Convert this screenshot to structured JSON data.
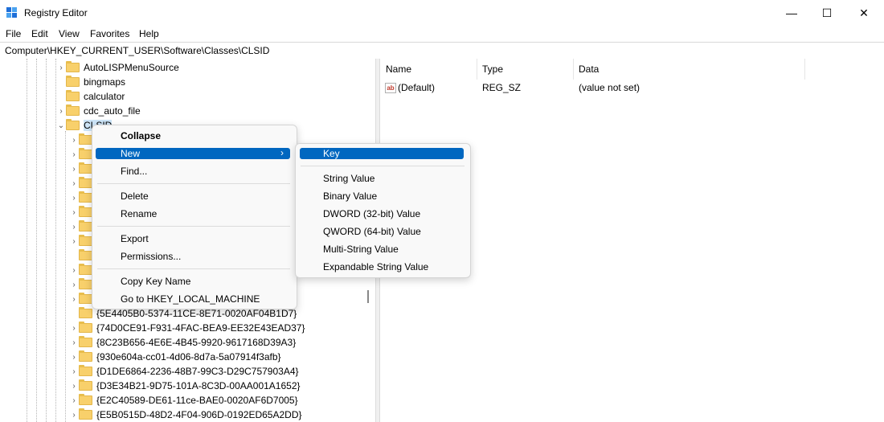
{
  "window": {
    "title": "Registry Editor",
    "minimize": "—",
    "maximize": "☐",
    "close": "✕"
  },
  "menu": [
    "File",
    "Edit",
    "View",
    "Favorites",
    "Help"
  ],
  "address": "Computer\\HKEY_CURRENT_USER\\Software\\Classes\\CLSID",
  "tree": {
    "top_items": [
      "AutoLISPMenuSource",
      "bingmaps",
      "calculator",
      "cdc_auto_file",
      "CLSID"
    ],
    "child_items": [
      "{5E4405B0-5374-11CE-8E71-0020AF04B1D7}",
      "{74D0CE91-F931-4FAC-BEA9-EE32E43EAD37}",
      "{8C23B656-4E6E-4B45-9920-9617168D39A3}",
      "{930e604a-cc01-4d06-8d7a-5a07914f3afb}",
      "{D1DE6864-2236-48B7-99C3-D29C757903A4}",
      "{D3E34B21-9D75-101A-8C3D-00AA001A1652}",
      "{E2C40589-DE61-11ce-BAE0-0020AF6D7005}",
      "{E5B0515D-48D2-4F04-906D-0192ED65A2DD}"
    ]
  },
  "list": {
    "headers": [
      "Name",
      "Type",
      "Data"
    ],
    "rows": [
      {
        "name": "(Default)",
        "type": "REG_SZ",
        "data": "(value not set)",
        "icon": "ab"
      }
    ]
  },
  "context_menu": {
    "items": [
      "Collapse",
      "New",
      "Find...",
      "Delete",
      "Rename",
      "Export",
      "Permissions...",
      "Copy Key Name",
      "Go to HKEY_LOCAL_MACHINE"
    ],
    "arrow": "›"
  },
  "submenu": {
    "items": [
      "Key",
      "String Value",
      "Binary Value",
      "DWORD (32-bit) Value",
      "QWORD (64-bit) Value",
      "Multi-String Value",
      "Expandable String Value"
    ]
  }
}
